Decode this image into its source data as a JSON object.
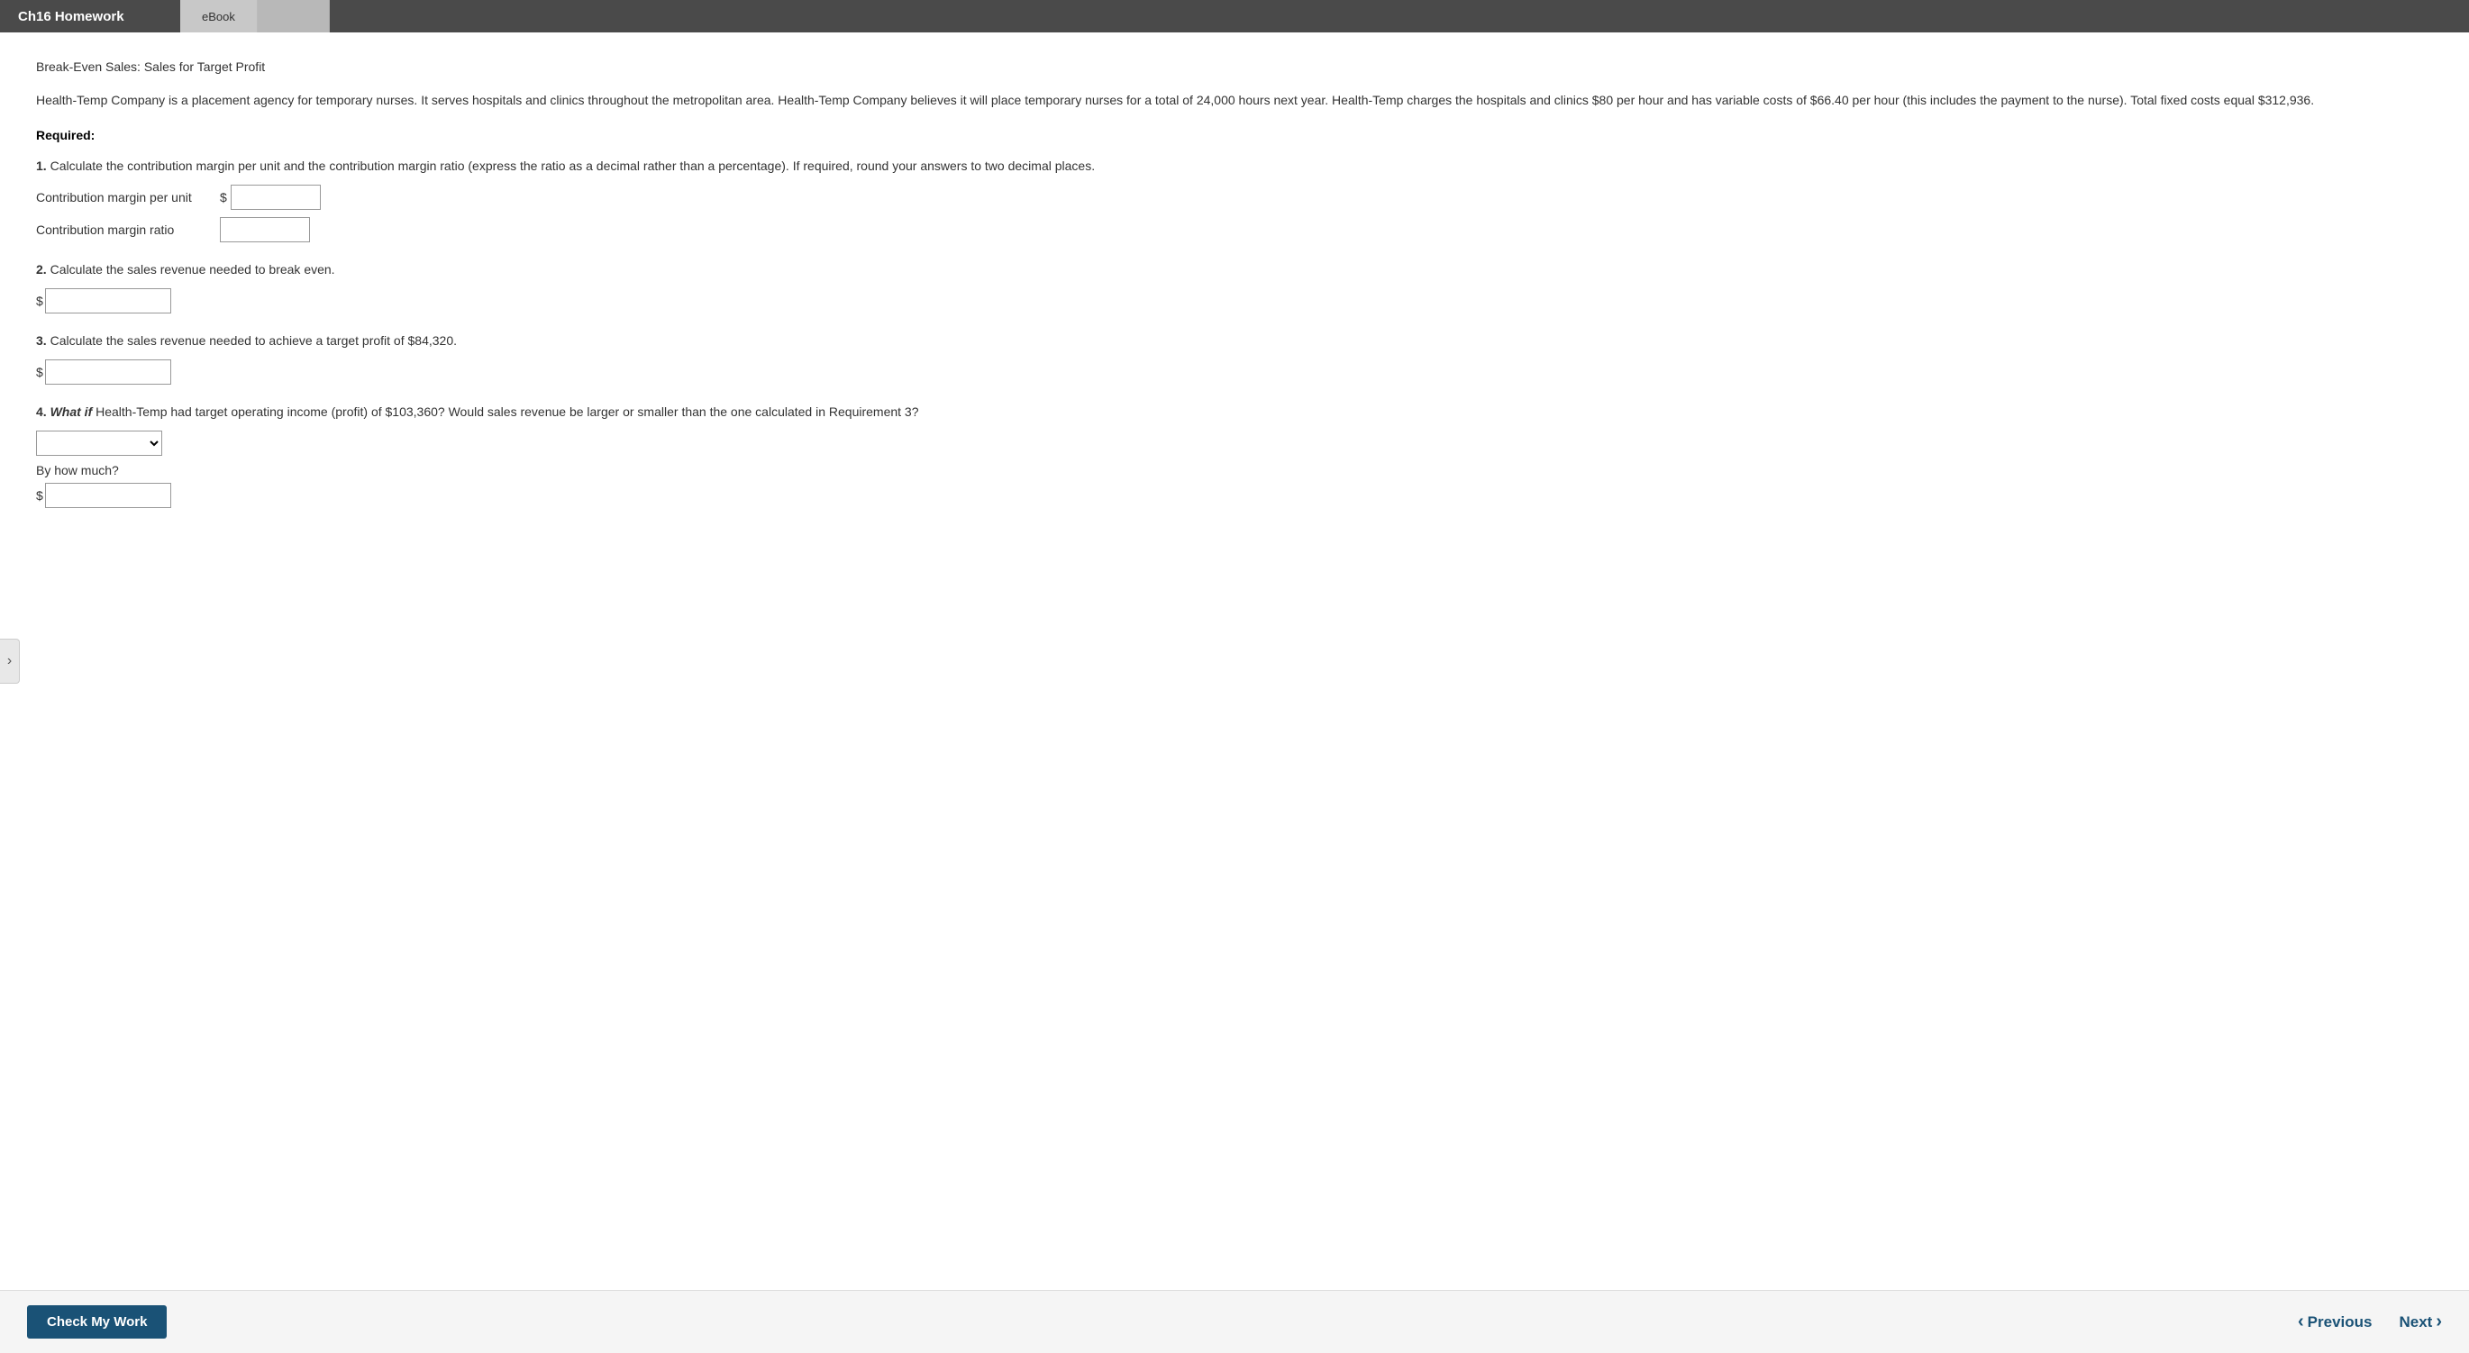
{
  "header": {
    "title": "Ch16 Homework",
    "tabs": [
      {
        "label": "eBook",
        "active": true
      },
      {
        "label": "",
        "active": false
      }
    ]
  },
  "main": {
    "subtitle": "Break-Even Sales: Sales for Target Profit",
    "problem_text": "Health-Temp Company is a placement agency for temporary nurses. It serves hospitals and clinics throughout the metropolitan area. Health-Temp Company believes it will place temporary nurses for a total of 24,000 hours next year. Health-Temp charges the hospitals and clinics $80 per hour and has variable costs of $66.40 per hour (this includes the payment to the nurse). Total fixed costs equal $312,936.",
    "required_label": "Required:",
    "questions": [
      {
        "number": "1.",
        "text": "Calculate the contribution margin per unit and the contribution margin ratio (express the ratio as a decimal rather than a percentage). If required, round your answers to two decimal places.",
        "inputs": [
          {
            "label": "Contribution margin per unit",
            "has_dollar": true,
            "type": "text",
            "name": "contribution-margin-per-unit"
          },
          {
            "label": "Contribution margin ratio",
            "has_dollar": false,
            "type": "text",
            "name": "contribution-margin-ratio"
          }
        ]
      },
      {
        "number": "2.",
        "text": "Calculate the sales revenue needed to break even.",
        "inputs": [
          {
            "label": "",
            "has_dollar": true,
            "type": "text",
            "name": "break-even-sales"
          }
        ]
      },
      {
        "number": "3.",
        "text": "Calculate the sales revenue needed to achieve a target profit of $84,320.",
        "inputs": [
          {
            "label": "",
            "has_dollar": true,
            "type": "text",
            "name": "target-profit-sales"
          }
        ]
      },
      {
        "number": "4.",
        "text_parts": {
          "bold_prefix": "What if",
          "rest": " Health-Temp had target operating income (profit) of $103,360? Would sales revenue be larger or smaller than the one calculated in Requirement 3?"
        },
        "has_select": true,
        "select_name": "larger-smaller-select",
        "by_how_much_label": "By how much?",
        "inputs": [
          {
            "label": "",
            "has_dollar": true,
            "type": "text",
            "name": "by-how-much-input"
          }
        ]
      }
    ]
  },
  "footer": {
    "check_my_work_label": "Check My Work",
    "previous_label": "Previous",
    "next_label": "Next"
  },
  "sidebar_toggle_icon": "›"
}
